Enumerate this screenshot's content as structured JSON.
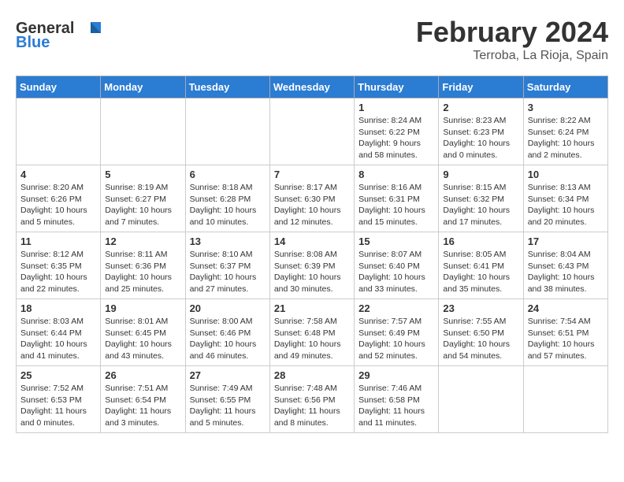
{
  "logo": {
    "general": "General",
    "blue": "Blue"
  },
  "title": "February 2024",
  "subtitle": "Terroba, La Rioja, Spain",
  "days_of_week": [
    "Sunday",
    "Monday",
    "Tuesday",
    "Wednesday",
    "Thursday",
    "Friday",
    "Saturday"
  ],
  "weeks": [
    [
      {
        "day": "",
        "info": ""
      },
      {
        "day": "",
        "info": ""
      },
      {
        "day": "",
        "info": ""
      },
      {
        "day": "",
        "info": ""
      },
      {
        "day": "1",
        "info": "Sunrise: 8:24 AM\nSunset: 6:22 PM\nDaylight: 9 hours\nand 58 minutes."
      },
      {
        "day": "2",
        "info": "Sunrise: 8:23 AM\nSunset: 6:23 PM\nDaylight: 10 hours\nand 0 minutes."
      },
      {
        "day": "3",
        "info": "Sunrise: 8:22 AM\nSunset: 6:24 PM\nDaylight: 10 hours\nand 2 minutes."
      }
    ],
    [
      {
        "day": "4",
        "info": "Sunrise: 8:20 AM\nSunset: 6:26 PM\nDaylight: 10 hours\nand 5 minutes."
      },
      {
        "day": "5",
        "info": "Sunrise: 8:19 AM\nSunset: 6:27 PM\nDaylight: 10 hours\nand 7 minutes."
      },
      {
        "day": "6",
        "info": "Sunrise: 8:18 AM\nSunset: 6:28 PM\nDaylight: 10 hours\nand 10 minutes."
      },
      {
        "day": "7",
        "info": "Sunrise: 8:17 AM\nSunset: 6:30 PM\nDaylight: 10 hours\nand 12 minutes."
      },
      {
        "day": "8",
        "info": "Sunrise: 8:16 AM\nSunset: 6:31 PM\nDaylight: 10 hours\nand 15 minutes."
      },
      {
        "day": "9",
        "info": "Sunrise: 8:15 AM\nSunset: 6:32 PM\nDaylight: 10 hours\nand 17 minutes."
      },
      {
        "day": "10",
        "info": "Sunrise: 8:13 AM\nSunset: 6:34 PM\nDaylight: 10 hours\nand 20 minutes."
      }
    ],
    [
      {
        "day": "11",
        "info": "Sunrise: 8:12 AM\nSunset: 6:35 PM\nDaylight: 10 hours\nand 22 minutes."
      },
      {
        "day": "12",
        "info": "Sunrise: 8:11 AM\nSunset: 6:36 PM\nDaylight: 10 hours\nand 25 minutes."
      },
      {
        "day": "13",
        "info": "Sunrise: 8:10 AM\nSunset: 6:37 PM\nDaylight: 10 hours\nand 27 minutes."
      },
      {
        "day": "14",
        "info": "Sunrise: 8:08 AM\nSunset: 6:39 PM\nDaylight: 10 hours\nand 30 minutes."
      },
      {
        "day": "15",
        "info": "Sunrise: 8:07 AM\nSunset: 6:40 PM\nDaylight: 10 hours\nand 33 minutes."
      },
      {
        "day": "16",
        "info": "Sunrise: 8:05 AM\nSunset: 6:41 PM\nDaylight: 10 hours\nand 35 minutes."
      },
      {
        "day": "17",
        "info": "Sunrise: 8:04 AM\nSunset: 6:43 PM\nDaylight: 10 hours\nand 38 minutes."
      }
    ],
    [
      {
        "day": "18",
        "info": "Sunrise: 8:03 AM\nSunset: 6:44 PM\nDaylight: 10 hours\nand 41 minutes."
      },
      {
        "day": "19",
        "info": "Sunrise: 8:01 AM\nSunset: 6:45 PM\nDaylight: 10 hours\nand 43 minutes."
      },
      {
        "day": "20",
        "info": "Sunrise: 8:00 AM\nSunset: 6:46 PM\nDaylight: 10 hours\nand 46 minutes."
      },
      {
        "day": "21",
        "info": "Sunrise: 7:58 AM\nSunset: 6:48 PM\nDaylight: 10 hours\nand 49 minutes."
      },
      {
        "day": "22",
        "info": "Sunrise: 7:57 AM\nSunset: 6:49 PM\nDaylight: 10 hours\nand 52 minutes."
      },
      {
        "day": "23",
        "info": "Sunrise: 7:55 AM\nSunset: 6:50 PM\nDaylight: 10 hours\nand 54 minutes."
      },
      {
        "day": "24",
        "info": "Sunrise: 7:54 AM\nSunset: 6:51 PM\nDaylight: 10 hours\nand 57 minutes."
      }
    ],
    [
      {
        "day": "25",
        "info": "Sunrise: 7:52 AM\nSunset: 6:53 PM\nDaylight: 11 hours\nand 0 minutes."
      },
      {
        "day": "26",
        "info": "Sunrise: 7:51 AM\nSunset: 6:54 PM\nDaylight: 11 hours\nand 3 minutes."
      },
      {
        "day": "27",
        "info": "Sunrise: 7:49 AM\nSunset: 6:55 PM\nDaylight: 11 hours\nand 5 minutes."
      },
      {
        "day": "28",
        "info": "Sunrise: 7:48 AM\nSunset: 6:56 PM\nDaylight: 11 hours\nand 8 minutes."
      },
      {
        "day": "29",
        "info": "Sunrise: 7:46 AM\nSunset: 6:58 PM\nDaylight: 11 hours\nand 11 minutes."
      },
      {
        "day": "",
        "info": ""
      },
      {
        "day": "",
        "info": ""
      }
    ]
  ]
}
